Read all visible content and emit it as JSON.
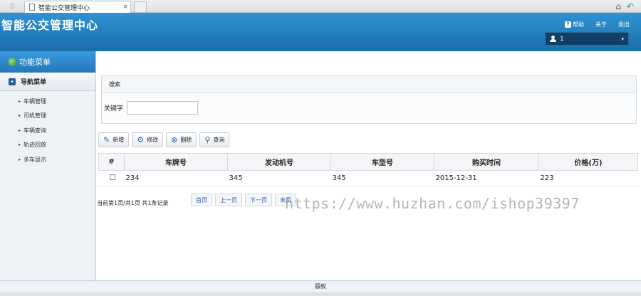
{
  "browser": {
    "tab_title": "智能公交管理中心",
    "tab_close": "×"
  },
  "header": {
    "title": "智能公交管理中心",
    "links": {
      "help": "帮助",
      "about": "关于",
      "logout": "退出"
    },
    "user": {
      "name": "1"
    }
  },
  "sidebar": {
    "title": "功能菜单",
    "group_label": "导航菜单",
    "items": [
      {
        "label": "车辆管理"
      },
      {
        "label": "司机管理"
      },
      {
        "label": "车辆查询"
      },
      {
        "label": "轨迹回放"
      },
      {
        "label": "多车显示"
      }
    ]
  },
  "search": {
    "title": "搜索",
    "keyword_label": "关键字",
    "keyword_value": ""
  },
  "toolbar": {
    "add": "新增",
    "edit": "修改",
    "delete": "删除",
    "query": "查询"
  },
  "table": {
    "columns": [
      "#",
      "车牌号",
      "发动机号",
      "车型号",
      "购买时间",
      "价格(万)"
    ],
    "rows": [
      {
        "plate": "234",
        "engine": "345",
        "model": "345",
        "purchase_date": "2015-12-31",
        "price": "223"
      }
    ]
  },
  "pager": {
    "info": "当前第1页/共1页  共1条记录",
    "first": "首页",
    "prev": "上一页",
    "next": "下一页",
    "last": "末页"
  },
  "footer": {
    "copyright": "版权"
  },
  "watermark": "https://www.huzhan.com/ishop39397",
  "colors": {
    "header_blue": "#1a6eaa",
    "sidebar_head": "#2577b8",
    "accent": "#2b64b8"
  }
}
